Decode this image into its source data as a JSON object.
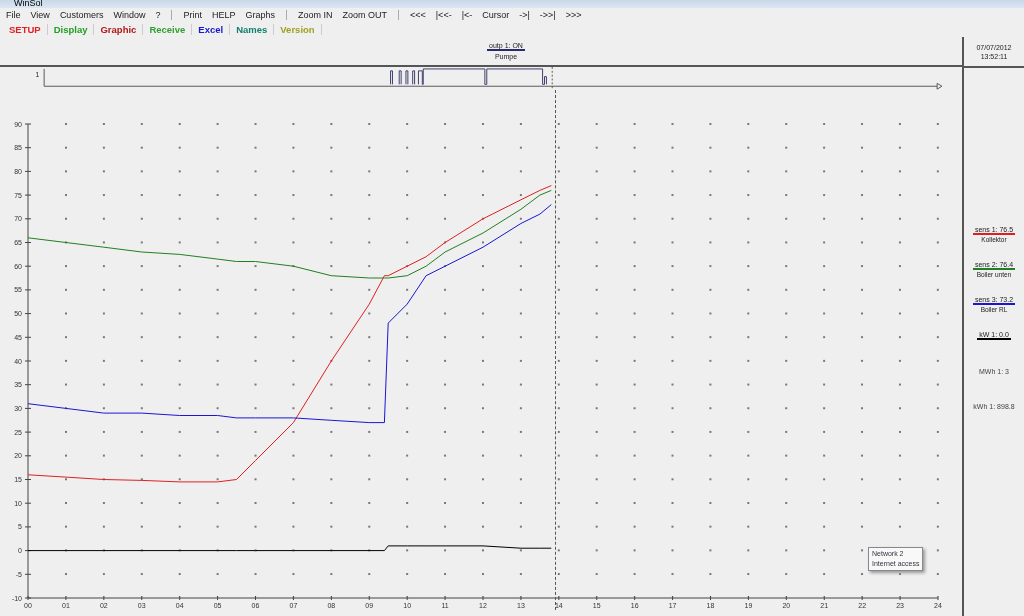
{
  "window": {
    "title": "WinSol"
  },
  "menu": [
    {
      "label": "File"
    },
    {
      "label": "View"
    },
    {
      "label": "Customers"
    },
    {
      "label": "Window"
    },
    {
      "label": "?",
      "group_end": true
    },
    {
      "label": "Print"
    },
    {
      "label": "HELP"
    },
    {
      "label": "Graphs",
      "group_end": true
    },
    {
      "label": "Zoom IN"
    },
    {
      "label": "Zoom OUT",
      "group_end": true
    },
    {
      "label": "<<<"
    },
    {
      "label": "|<<-"
    },
    {
      "label": "|<-"
    },
    {
      "label": "Cursor"
    },
    {
      "label": "->|"
    },
    {
      "label": "->>|"
    },
    {
      "label": ">>>"
    }
  ],
  "toolbar": [
    {
      "label": "SETUP",
      "color": "#e02020"
    },
    {
      "label": "Display",
      "color": "#20a020"
    },
    {
      "label": "Graphic",
      "color": "#b01818"
    },
    {
      "label": "Receive",
      "color": "#30a030"
    },
    {
      "label": "Excel",
      "color": "#1818d0"
    },
    {
      "label": "Names",
      "color": "#108070"
    },
    {
      "label": "Version",
      "color": "#a0a020"
    }
  ],
  "output": {
    "label": "outp 1: ON",
    "name": "Pumpe",
    "strip_label": "1"
  },
  "clock": {
    "date": "07/07/2012",
    "time": "13:52:11"
  },
  "legend": [
    {
      "value": "76.5",
      "name": "Kollektor"
    },
    {
      "value": "76.4",
      "name": "Boiler unten"
    },
    {
      "value": "73.2",
      "name": "Boiler RL"
    },
    {
      "value": "0.0"
    }
  ],
  "readings": [
    {
      "label": "MWh 1:",
      "value": "3"
    },
    {
      "label": "kWh 1:",
      "value": "898.8"
    }
  ],
  "chart_data": {
    "type": "line",
    "x": [
      0,
      1,
      2,
      3,
      4,
      5,
      5.5,
      6,
      7,
      8,
      9,
      9.4,
      9.5,
      10,
      10.5,
      11,
      12,
      13,
      13.5,
      13.8
    ],
    "xticks": [
      {
        "value": 0,
        "label": "00"
      },
      {
        "value": 1,
        "label": "01"
      },
      {
        "value": 2,
        "label": "02"
      },
      {
        "value": 3,
        "label": "03"
      },
      {
        "value": 4,
        "label": "04"
      },
      {
        "value": 5,
        "label": "05"
      },
      {
        "value": 6,
        "label": "06"
      },
      {
        "value": 7,
        "label": "07"
      },
      {
        "value": 8,
        "label": "08"
      },
      {
        "value": 9,
        "label": "09"
      },
      {
        "value": 10,
        "label": "10"
      },
      {
        "value": 11,
        "label": "11"
      },
      {
        "value": 12,
        "label": "12"
      },
      {
        "value": 13,
        "label": "13"
      },
      {
        "value": 14,
        "label": "14"
      },
      {
        "value": 15,
        "label": "15"
      },
      {
        "value": 16,
        "label": "16"
      },
      {
        "value": 17,
        "label": "17"
      },
      {
        "value": 18,
        "label": "18"
      },
      {
        "value": 19,
        "label": "19"
      },
      {
        "value": 20,
        "label": "20"
      },
      {
        "value": 21,
        "label": "21"
      },
      {
        "value": 22,
        "label": "22"
      },
      {
        "value": 23,
        "label": "23"
      },
      {
        "value": 24,
        "label": "24"
      }
    ],
    "yticks": [
      -10,
      -5,
      0,
      5,
      10,
      15,
      20,
      25,
      30,
      35,
      40,
      45,
      50,
      55,
      60,
      65,
      70,
      75,
      80,
      85,
      90
    ],
    "xlim": [
      0,
      24
    ],
    "ylim": [
      -10,
      90
    ],
    "series": [
      {
        "name": "sens 1:",
        "color": "#e02020",
        "values": [
          16,
          15.5,
          15,
          14.8,
          14.5,
          14.5,
          15,
          19,
          27,
          40,
          52,
          58,
          58,
          60,
          62,
          65,
          70,
          74,
          76,
          77
        ]
      },
      {
        "name": "sens 2:",
        "color": "#208020",
        "values": [
          66,
          65,
          64,
          63,
          62.5,
          61.5,
          61,
          61,
          60,
          58,
          57.5,
          57.5,
          57.5,
          58,
          60,
          63,
          67,
          72,
          75,
          76
        ]
      },
      {
        "name": "sens 3:",
        "color": "#1818d0",
        "values": [
          31,
          30,
          29,
          29,
          28.5,
          28.5,
          28,
          28,
          28,
          27.5,
          27,
          27,
          48,
          52,
          58,
          60,
          64,
          69,
          71,
          73
        ]
      },
      {
        "name": "kW 1:",
        "color": "#000000",
        "values": [
          0,
          0,
          0,
          0,
          0,
          0,
          0,
          0,
          0,
          0,
          0,
          0,
          1,
          1,
          1,
          1,
          1,
          0.5,
          0.5,
          0.5
        ]
      }
    ]
  },
  "tooltip": {
    "title": "Network 2",
    "text": "Internet access"
  }
}
